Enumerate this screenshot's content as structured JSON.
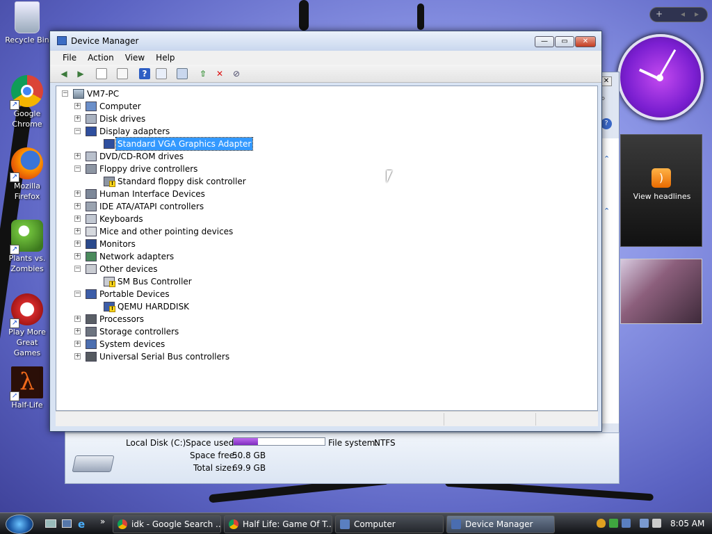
{
  "desktop": {
    "icons": [
      {
        "label": "Recycle Bin",
        "icon": "recycle-bin-icon"
      },
      {
        "label": "Google Chrome",
        "icon": "chrome-icon"
      },
      {
        "label": "Mozilla Firefox",
        "icon": "firefox-icon"
      },
      {
        "label": "Plants vs. Zombies",
        "icon": "plants-vs-zombies-icon"
      },
      {
        "label": "Play More Great Games",
        "icon": "popcap-icon"
      },
      {
        "label": "Half-Life",
        "icon": "half-life-icon"
      }
    ]
  },
  "sidebar": {
    "add_label": "+",
    "prev_label": "◂",
    "next_label": "▸",
    "feed_label": "View headlines"
  },
  "window": {
    "title": "Device Manager",
    "menu": [
      "File",
      "Action",
      "View",
      "Help"
    ],
    "buttons": {
      "minimize": "—",
      "maximize": "▭",
      "close": "✕"
    },
    "toolbar_icons": [
      "back-icon",
      "forward-icon",
      "up-icon",
      "show-hide-icon",
      "help-icon",
      "properties-icon",
      "scan-icon",
      "update-driver-icon",
      "uninstall-icon",
      "disable-icon"
    ]
  },
  "tree": {
    "root": "VM7-PC",
    "items": [
      {
        "label": "Computer",
        "level": 1,
        "expanded": false,
        "icon": "computer-icon"
      },
      {
        "label": "Disk drives",
        "level": 1,
        "expanded": false,
        "icon": "disk-drive-icon"
      },
      {
        "label": "Display adapters",
        "level": 1,
        "expanded": true,
        "icon": "display-adapter-icon"
      },
      {
        "label": "Standard VGA Graphics Adapter",
        "level": 2,
        "selected": true,
        "icon": "vga-adapter-icon"
      },
      {
        "label": "DVD/CD-ROM drives",
        "level": 1,
        "expanded": false,
        "icon": "dvd-drive-icon"
      },
      {
        "label": "Floppy drive controllers",
        "level": 1,
        "expanded": true,
        "icon": "floppy-controller-icon"
      },
      {
        "label": "Standard floppy disk controller",
        "level": 2,
        "warning": true,
        "icon": "floppy-controller-icon"
      },
      {
        "label": "Human Interface Devices",
        "level": 1,
        "expanded": false,
        "icon": "hid-icon"
      },
      {
        "label": "IDE ATA/ATAPI controllers",
        "level": 1,
        "expanded": false,
        "icon": "ide-controller-icon"
      },
      {
        "label": "Keyboards",
        "level": 1,
        "expanded": false,
        "icon": "keyboard-icon"
      },
      {
        "label": "Mice and other pointing devices",
        "level": 1,
        "expanded": false,
        "icon": "mouse-icon"
      },
      {
        "label": "Monitors",
        "level": 1,
        "expanded": false,
        "icon": "monitor-icon"
      },
      {
        "label": "Network adapters",
        "level": 1,
        "expanded": false,
        "icon": "network-adapter-icon"
      },
      {
        "label": "Other devices",
        "level": 1,
        "expanded": true,
        "icon": "other-devices-icon"
      },
      {
        "label": "SM Bus Controller",
        "level": 2,
        "warning": true,
        "icon": "unknown-device-icon"
      },
      {
        "label": "Portable Devices",
        "level": 1,
        "expanded": true,
        "icon": "portable-device-icon"
      },
      {
        "label": "QEMU HARDDISK",
        "level": 2,
        "warning": true,
        "icon": "portable-device-icon"
      },
      {
        "label": "Processors",
        "level": 1,
        "expanded": false,
        "icon": "processor-icon"
      },
      {
        "label": "Storage controllers",
        "level": 1,
        "expanded": false,
        "icon": "storage-controller-icon"
      },
      {
        "label": "System devices",
        "level": 1,
        "expanded": false,
        "icon": "system-devices-icon"
      },
      {
        "label": "Universal Serial Bus controllers",
        "level": 1,
        "expanded": false,
        "icon": "usb-icon"
      }
    ]
  },
  "details_pane": {
    "drive_name": "Local Disk (C:)",
    "space_used_label": "Space used:",
    "space_used_fraction": 0.27,
    "file_system_label": "File system:",
    "file_system_value": "NTFS",
    "space_free_label": "Space free:",
    "space_free_value": "50.8 GB",
    "total_size_label": "Total size:",
    "total_size_value": "69.9 GB"
  },
  "taskbar": {
    "tasks": [
      {
        "label": "idk - Google Search ...",
        "icon": "chrome-icon",
        "active": false
      },
      {
        "label": "Half Life: Game Of T...",
        "icon": "chrome-icon",
        "active": false
      },
      {
        "label": "Computer",
        "icon": "computer-icon",
        "active": false
      },
      {
        "label": "Device Manager",
        "icon": "device-manager-icon",
        "active": true
      }
    ],
    "overflow": "»",
    "time": "8:05 AM"
  },
  "colors": {
    "selection": "#3399ff",
    "space_bar": "#9b3fd6",
    "warning": "#f8d51b"
  }
}
